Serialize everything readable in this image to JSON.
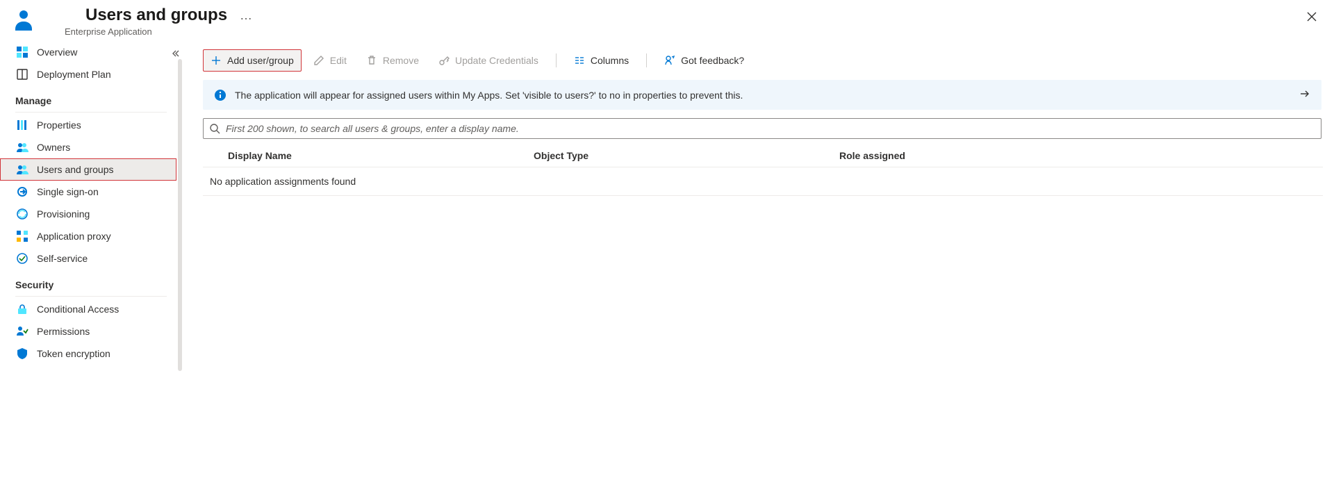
{
  "header": {
    "title": "Users and groups",
    "subtitle": "Enterprise Application"
  },
  "sidebar": {
    "top": [
      {
        "id": "overview",
        "label": "Overview"
      },
      {
        "id": "deployment-plan",
        "label": "Deployment Plan"
      }
    ],
    "manage_header": "Manage",
    "manage": [
      {
        "id": "properties",
        "label": "Properties"
      },
      {
        "id": "owners",
        "label": "Owners"
      },
      {
        "id": "users-groups",
        "label": "Users and groups",
        "selected": true
      },
      {
        "id": "single-sign-on",
        "label": "Single sign-on"
      },
      {
        "id": "provisioning",
        "label": "Provisioning"
      },
      {
        "id": "application-proxy",
        "label": "Application proxy"
      },
      {
        "id": "self-service",
        "label": "Self-service"
      }
    ],
    "security_header": "Security",
    "security": [
      {
        "id": "conditional-access",
        "label": "Conditional Access"
      },
      {
        "id": "permissions",
        "label": "Permissions"
      },
      {
        "id": "token-encryption",
        "label": "Token encryption"
      }
    ]
  },
  "toolbar": {
    "add": "Add user/group",
    "edit": "Edit",
    "remove": "Remove",
    "update_credentials": "Update Credentials",
    "columns": "Columns",
    "feedback": "Got feedback?"
  },
  "banner": {
    "text": "The application will appear for assigned users within My Apps. Set 'visible to users?' to no in properties to prevent this."
  },
  "search": {
    "placeholder": "First 200 shown, to search all users & groups, enter a display name."
  },
  "table": {
    "headers": {
      "display_name": "Display Name",
      "object_type": "Object Type",
      "role": "Role assigned"
    },
    "empty": "No application assignments found"
  }
}
